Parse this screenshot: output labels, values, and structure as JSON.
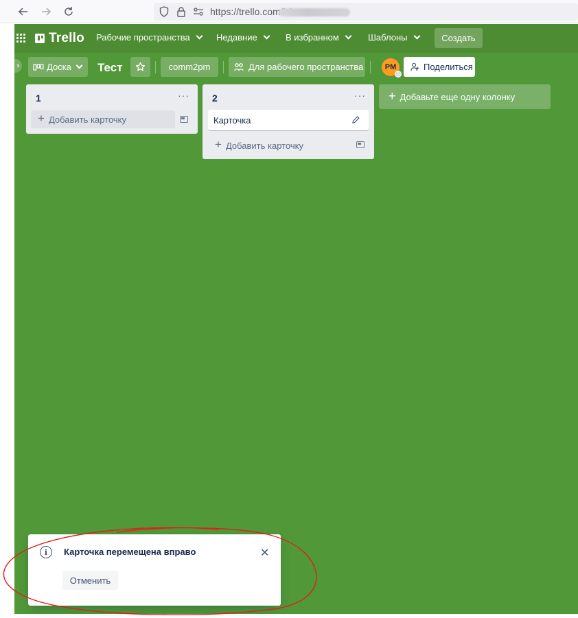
{
  "browser": {
    "url": "https://trello.com/b/",
    "back_icon": "arrow-left-icon",
    "forward_icon": "arrow-right-icon",
    "reload_icon": "reload-icon"
  },
  "header": {
    "logo_text": "Trello",
    "menus": [
      {
        "label": "Рабочие пространства"
      },
      {
        "label": "Недавние"
      },
      {
        "label": "В избранном"
      },
      {
        "label": "Шаблоны"
      }
    ],
    "create_label": "Создать",
    "color": "#4d8c33"
  },
  "board": {
    "view_label": "Доска",
    "title": "Тест",
    "workspace_label": "comm2pm",
    "visibility_label": "Для рабочего пространства",
    "avatar_initials": "PM",
    "share_label": "Поделиться",
    "background": "#519839",
    "lists": [
      {
        "title": "1",
        "menu": "···",
        "add_card_label": "Добавить карточку",
        "cards": []
      },
      {
        "title": "2",
        "menu": "···",
        "add_card_label": "Добавить карточку",
        "cards": [
          {
            "title": "Карточка"
          }
        ]
      }
    ],
    "add_list_label": "Добавьте еще одну колонку"
  },
  "toast": {
    "message": "Карточка перемещена вправо",
    "undo_label": "Отменить",
    "close_symbol": "✕"
  },
  "annotation_color": "#e0201b"
}
